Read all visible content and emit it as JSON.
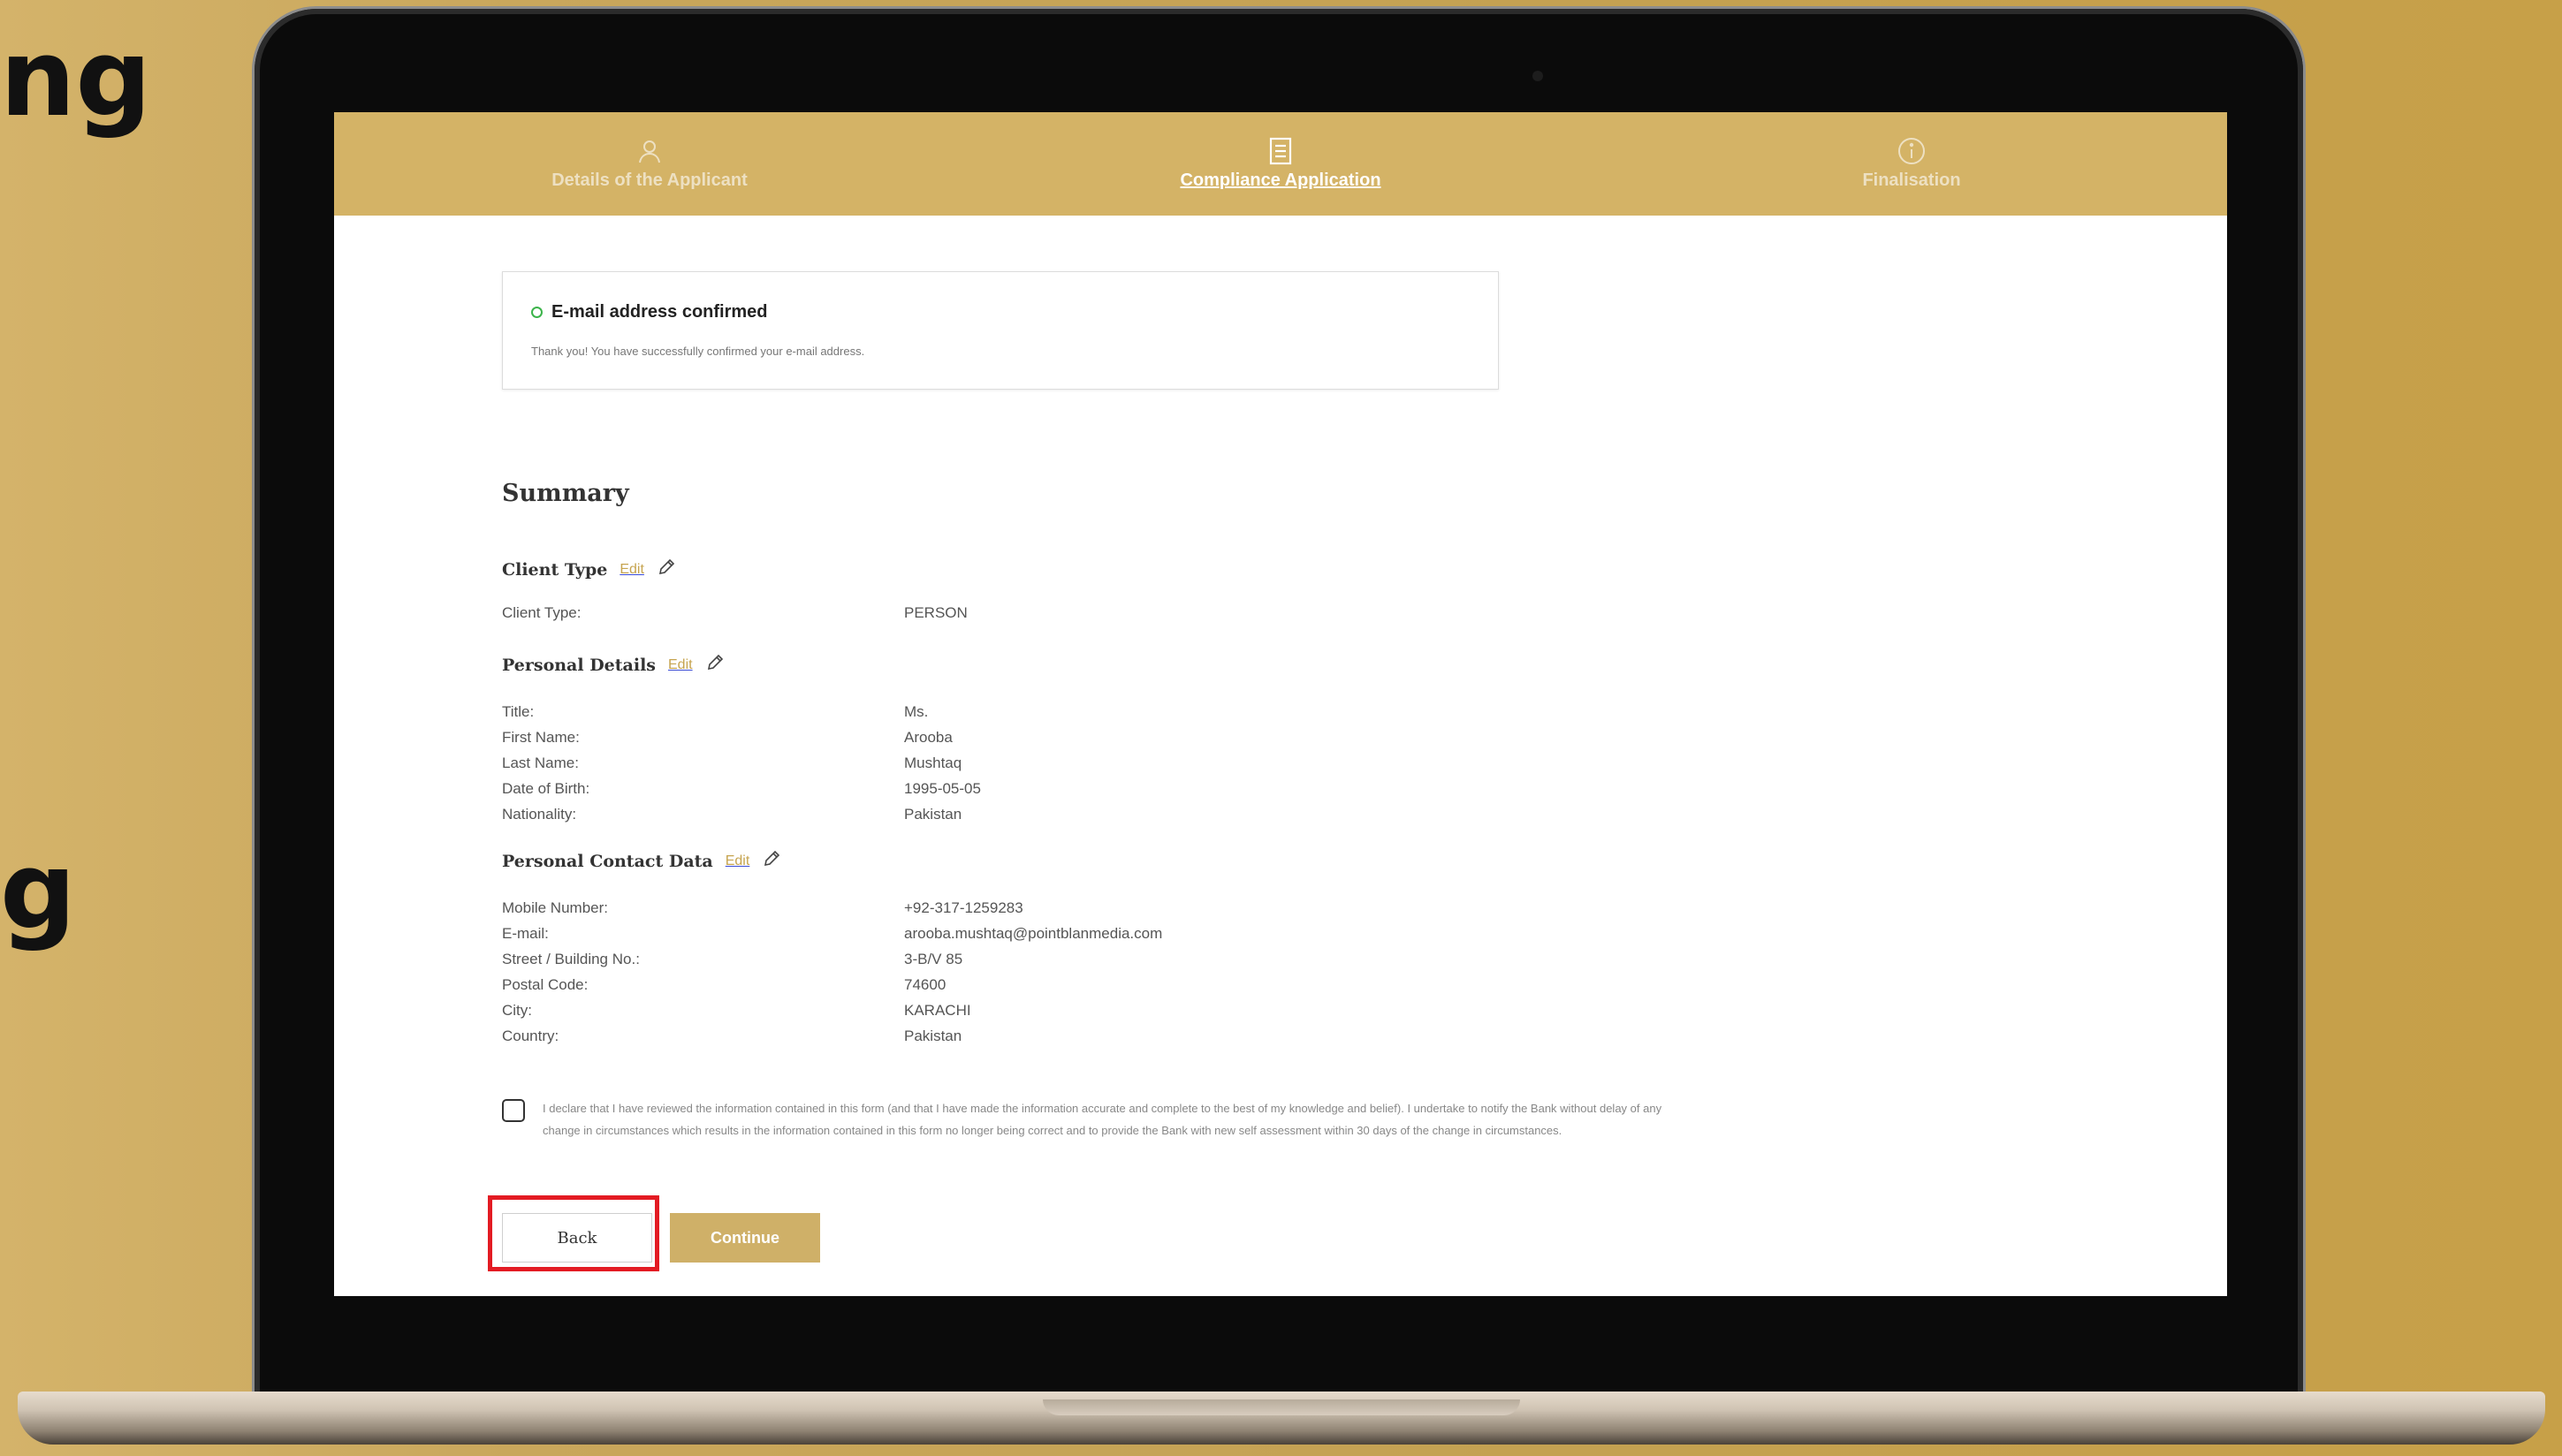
{
  "background": {
    "text_top": "ng",
    "text_bottom": "g"
  },
  "stepper": {
    "steps": [
      {
        "label": "Details of the Applicant",
        "icon": "user-icon",
        "state": "inactive"
      },
      {
        "label": "Compliance Application",
        "icon": "document-icon",
        "state": "active"
      },
      {
        "label": "Finalisation",
        "icon": "info-icon",
        "state": "inactive"
      }
    ]
  },
  "confirmation": {
    "title": "E-mail address confirmed",
    "message": "Thank you! You have successfully confirmed your e-mail address."
  },
  "summary": {
    "title": "Summary",
    "edit_label": "Edit",
    "sections": {
      "client_type": {
        "title": "Client Type",
        "rows": [
          {
            "label": "Client Type:",
            "value": "PERSON"
          }
        ]
      },
      "personal_details": {
        "title": "Personal Details",
        "rows": [
          {
            "label": "Title:",
            "value": "Ms."
          },
          {
            "label": "First Name:",
            "value": "Arooba"
          },
          {
            "label": "Last Name:",
            "value": "Mushtaq"
          },
          {
            "label": "Date of Birth:",
            "value": "1995-05-05"
          },
          {
            "label": "Nationality:",
            "value": "Pakistan"
          }
        ]
      },
      "contact_data": {
        "title": "Personal Contact Data",
        "rows": [
          {
            "label": "Mobile Number:",
            "value": "+92-317-1259283"
          },
          {
            "label": "E-mail:",
            "value": "arooba.mushtaq@pointblanmedia.com"
          },
          {
            "label": "Street / Building No.:",
            "value": "3-B/V 85"
          },
          {
            "label": "Postal Code:",
            "value": "74600"
          },
          {
            "label": "City:",
            "value": "KARACHI"
          },
          {
            "label": "Country:",
            "value": "Pakistan"
          }
        ]
      }
    }
  },
  "declaration": {
    "checked": false,
    "text": "I declare that I have reviewed the information contained in this form (and that I have made the information accurate and complete to the best of my knowledge and belief). I undertake to notify the Bank without delay of any change in circumstances which results in the information contained in this form no longer being correct and to provide the Bank with new self assessment within 30 days of the change in circumstances."
  },
  "actions": {
    "back_label": "Back",
    "continue_label": "Continue"
  },
  "colors": {
    "brand_gold": "#d4b366",
    "highlight_red": "#e31b23",
    "success_green": "#3cb44b"
  }
}
